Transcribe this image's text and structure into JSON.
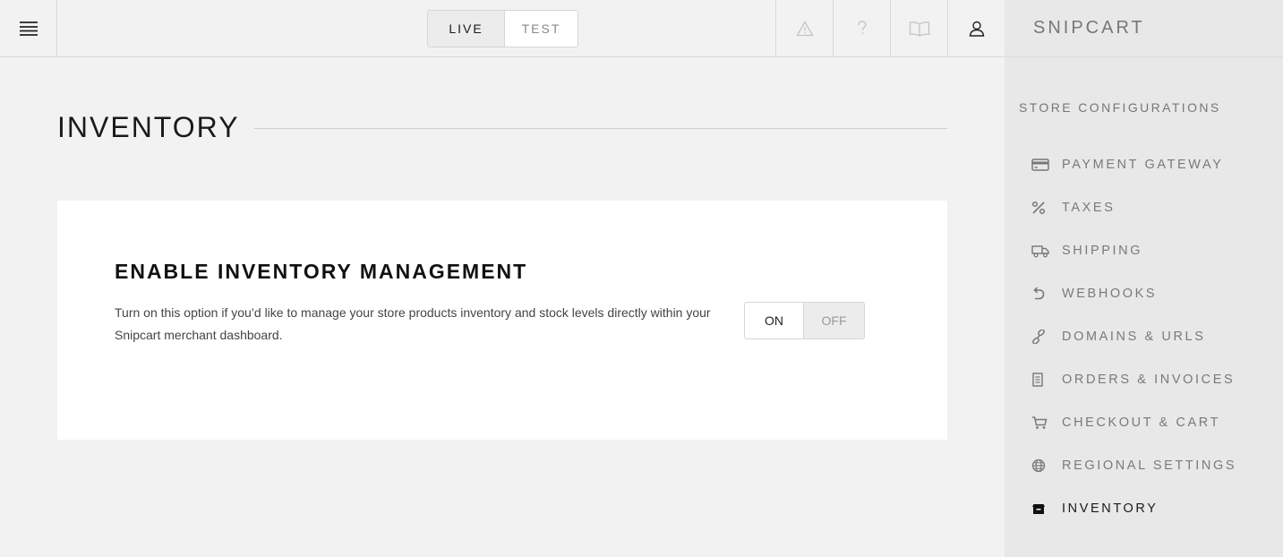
{
  "topbar": {
    "menu_icon": "hamburger-menu-icon",
    "environment": {
      "live_label": "LIVE",
      "test_label": "TEST",
      "selected": "LIVE"
    },
    "icons": [
      "warning-icon",
      "help-icon",
      "documentation-book-icon",
      "user-account-icon"
    ]
  },
  "sidebar": {
    "brand": "SNIPCART",
    "section_title": "STORE CONFIGURATIONS",
    "items": [
      {
        "label": "PAYMENT GATEWAY",
        "icon": "credit-card-icon"
      },
      {
        "label": "TAXES",
        "icon": "percent-icon"
      },
      {
        "label": "SHIPPING",
        "icon": "truck-icon"
      },
      {
        "label": "WEBHOOKS",
        "icon": "webhook-arrow-icon"
      },
      {
        "label": "DOMAINS & URLS",
        "icon": "link-icon"
      },
      {
        "label": "ORDERS & INVOICES",
        "icon": "receipt-icon"
      },
      {
        "label": "CHECKOUT & CART",
        "icon": "cart-icon"
      },
      {
        "label": "REGIONAL SETTINGS",
        "icon": "globe-icon"
      },
      {
        "label": "INVENTORY",
        "icon": "inventory-box-icon",
        "active": true
      }
    ]
  },
  "main": {
    "title": "INVENTORY",
    "card": {
      "title": "ENABLE INVENTORY MANAGEMENT",
      "description": "Turn on this option if you’d like to manage your store products inventory and stock levels directly within your Snipcart merchant dashboard.",
      "toggle": {
        "on_label": "ON",
        "off_label": "OFF",
        "selected": "ON"
      }
    }
  },
  "colors": {
    "background": "#f2f2f2",
    "sidebar": "#e8e8e8",
    "card": "#ffffff",
    "muted_text": "#7a7a7a",
    "active_text": "#1a1a1a"
  }
}
